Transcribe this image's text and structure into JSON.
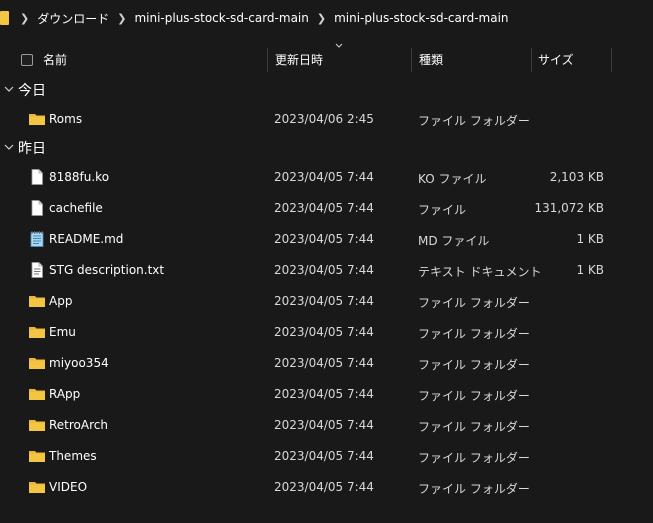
{
  "breadcrumb": {
    "items": [
      "ダウンロード",
      "mini-plus-stock-sd-card-main",
      "mini-plus-stock-sd-card-main"
    ]
  },
  "columns": {
    "name": "名前",
    "date": "更新日時",
    "type": "種類",
    "size": "サイズ"
  },
  "groups": [
    {
      "label": "今日",
      "rows": [
        {
          "name": "Roms",
          "date": "2023/04/06 2:45",
          "type": "ファイル フォルダー",
          "size": "",
          "icon": "folder-icon"
        }
      ]
    },
    {
      "label": "昨日",
      "rows": [
        {
          "name": "8188fu.ko",
          "date": "2023/04/05 7:44",
          "type": "KO ファイル",
          "size": "2,103 KB",
          "icon": "file-icon"
        },
        {
          "name": "cachefile",
          "date": "2023/04/05 7:44",
          "type": "ファイル",
          "size": "131,072 KB",
          "icon": "file-icon"
        },
        {
          "name": "README.md",
          "date": "2023/04/05 7:44",
          "type": "MD ファイル",
          "size": "1 KB",
          "icon": "notepad-icon"
        },
        {
          "name": "STG description.txt",
          "date": "2023/04/05 7:44",
          "type": "テキスト ドキュメント",
          "size": "1 KB",
          "icon": "text-file-icon"
        },
        {
          "name": "App",
          "date": "2023/04/05 7:44",
          "type": "ファイル フォルダー",
          "size": "",
          "icon": "folder-icon"
        },
        {
          "name": "Emu",
          "date": "2023/04/05 7:44",
          "type": "ファイル フォルダー",
          "size": "",
          "icon": "folder-icon"
        },
        {
          "name": "miyoo354",
          "date": "2023/04/05 7:44",
          "type": "ファイル フォルダー",
          "size": "",
          "icon": "folder-icon"
        },
        {
          "name": "RApp",
          "date": "2023/04/05 7:44",
          "type": "ファイル フォルダー",
          "size": "",
          "icon": "folder-icon"
        },
        {
          "name": "RetroArch",
          "date": "2023/04/05 7:44",
          "type": "ファイル フォルダー",
          "size": "",
          "icon": "folder-icon"
        },
        {
          "name": "Themes",
          "date": "2023/04/05 7:44",
          "type": "ファイル フォルダー",
          "size": "",
          "icon": "folder-icon"
        },
        {
          "name": "VIDEO",
          "date": "2023/04/05 7:44",
          "type": "ファイル フォルダー",
          "size": "",
          "icon": "folder-icon"
        }
      ]
    }
  ],
  "colors": {
    "background": "#191919",
    "folder": "#f4c542",
    "divider": "#3a3a3a"
  }
}
